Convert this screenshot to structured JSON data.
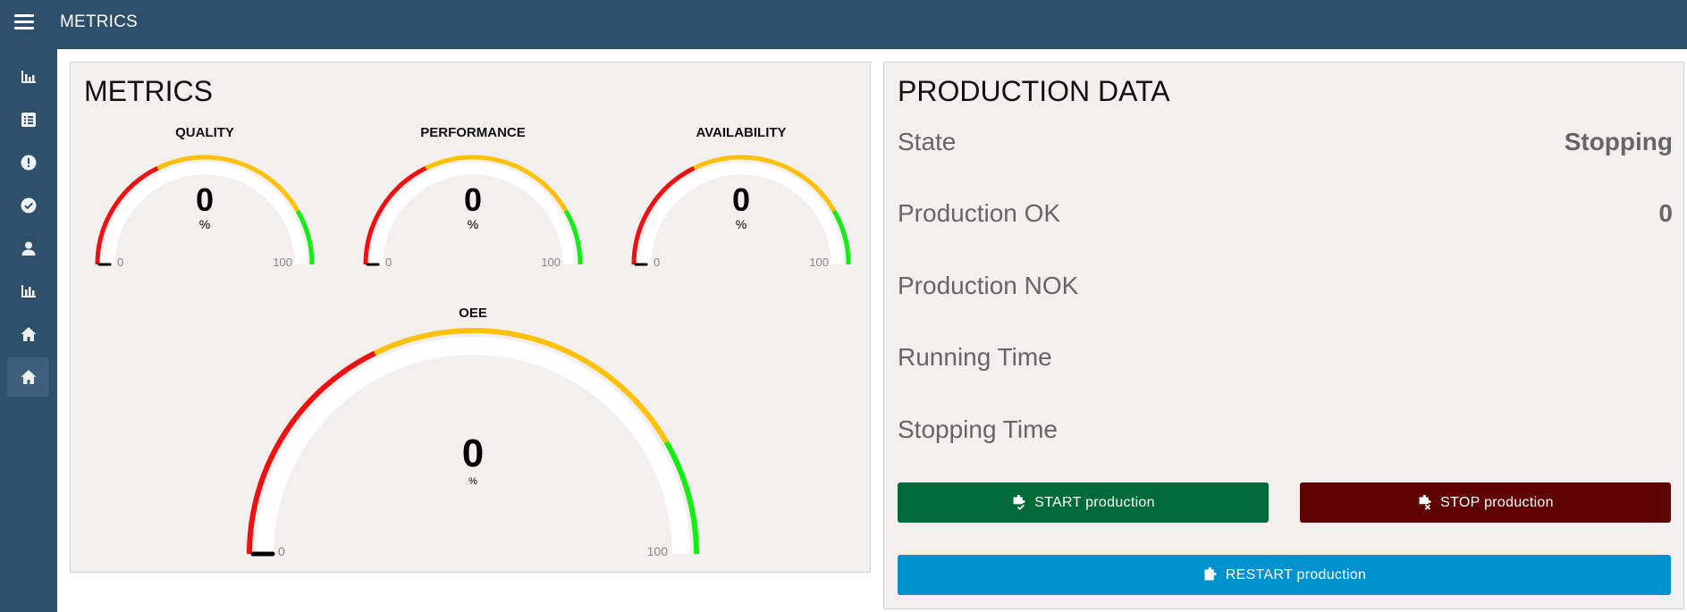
{
  "header": {
    "title": "METRICS",
    "menu_icon": "hamburger-menu-icon"
  },
  "sidebar": {
    "items": [
      {
        "name": "sidebar-item-chart",
        "icon": "bar-chart-icon"
      },
      {
        "name": "sidebar-item-list",
        "icon": "list-icon"
      },
      {
        "name": "sidebar-item-alerts",
        "icon": "alert-icon"
      },
      {
        "name": "sidebar-item-check",
        "icon": "check-circle-icon"
      },
      {
        "name": "sidebar-item-user",
        "icon": "user-icon"
      },
      {
        "name": "sidebar-item-stats",
        "icon": "bar-chart-icon"
      },
      {
        "name": "sidebar-item-home",
        "icon": "home-icon"
      },
      {
        "name": "sidebar-item-home-active",
        "icon": "home-icon",
        "active": true
      }
    ]
  },
  "metrics": {
    "title": "METRICS",
    "gauges": [
      {
        "key": "quality",
        "label": "QUALITY",
        "value": "0",
        "unit": "%",
        "min": "0",
        "max": "100"
      },
      {
        "key": "performance",
        "label": "PERFORMANCE",
        "value": "0",
        "unit": "%",
        "min": "0",
        "max": "100"
      },
      {
        "key": "availability",
        "label": "AVAILABILITY",
        "value": "0",
        "unit": "%",
        "min": "0",
        "max": "100"
      },
      {
        "key": "oee",
        "label": "OEE",
        "value": "0",
        "unit": "%",
        "min": "0",
        "max": "100"
      }
    ],
    "colors": {
      "red": "#ee1111",
      "yellow": "#ffc107",
      "green": "#11ee11"
    }
  },
  "production": {
    "title": "PRODUCTION DATA",
    "state_label": "State",
    "state_value": "Stopping",
    "ok_label": "Production OK",
    "ok_value": "0",
    "nok_label": "Production NOK",
    "nok_value": "",
    "running_label": "Running Time",
    "running_value": "",
    "stopping_label": "Stopping Time",
    "stopping_value": "",
    "start_label": "START production",
    "stop_label": "STOP production",
    "restart_label": "RESTART production",
    "colors": {
      "start": "#006b38",
      "stop": "#5e0404",
      "restart": "#0092cf"
    }
  }
}
